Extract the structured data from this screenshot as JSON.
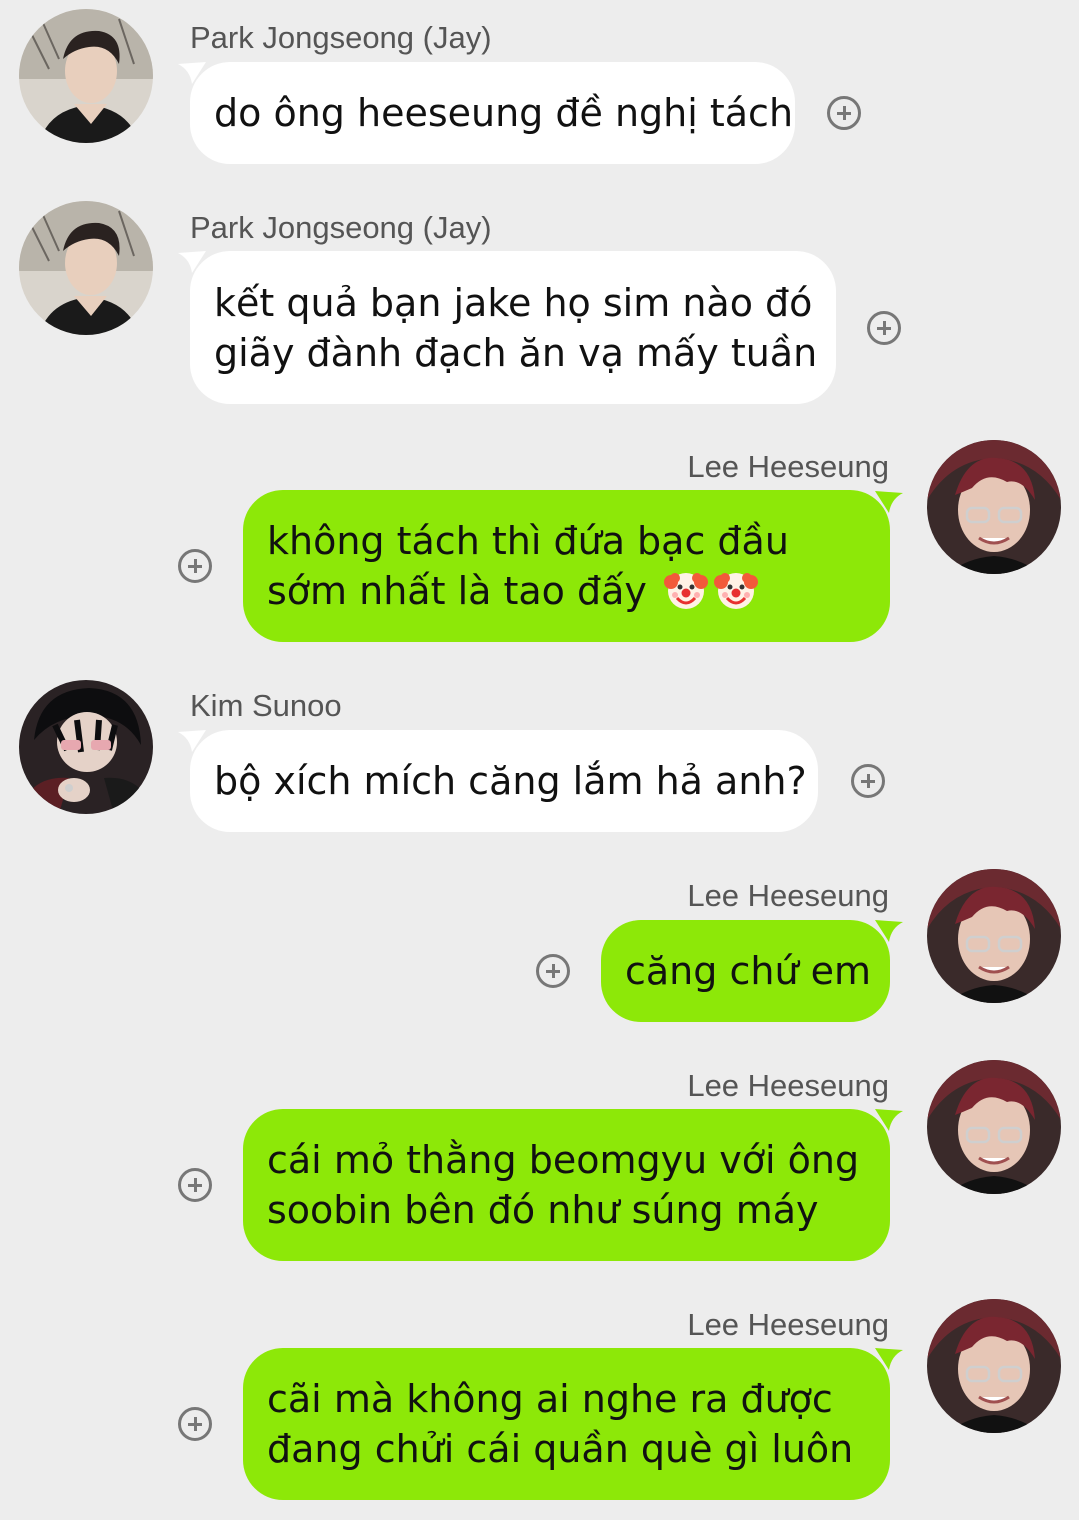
{
  "messages": [
    {
      "sender": "Park Jongseong (Jay)",
      "direction": "in",
      "lines": [
        "do ông heeseung đề nghị tách"
      ]
    },
    {
      "sender": "Park Jongseong (Jay)",
      "direction": "in",
      "lines": [
        "kết quả bạn jake họ sim nào đó",
        "giãy đành đạch ăn vạ mấy tuần"
      ]
    },
    {
      "sender": "Lee Heeseung",
      "direction": "out",
      "lines": [
        "không tách thì đứa bạc đầu",
        "sớm nhất là tao đấy"
      ],
      "emoji": [
        "clown-face-emoji",
        "clown-face-emoji"
      ]
    },
    {
      "sender": "Kim Sunoo",
      "direction": "in",
      "lines": [
        "bộ xích mích căng lắm hả anh?"
      ]
    },
    {
      "sender": "Lee Heeseung",
      "direction": "out",
      "lines": [
        "căng chứ em"
      ]
    },
    {
      "sender": "Lee Heeseung",
      "direction": "out",
      "lines": [
        "cái mỏ thằng beomgyu với ông",
        "soobin bên đó như súng máy"
      ]
    },
    {
      "sender": "Lee Heeseung",
      "direction": "out",
      "lines": [
        "cãi mà không ai nghe ra được",
        "đang chửi cái quần què gì luôn"
      ]
    }
  ],
  "colors": {
    "background": "#ededed",
    "incoming_bubble": "#ffffff",
    "outgoing_bubble": "#8de808",
    "icon_gray": "#777777"
  },
  "icons": {
    "reaction_button": "plus-circle-icon"
  }
}
